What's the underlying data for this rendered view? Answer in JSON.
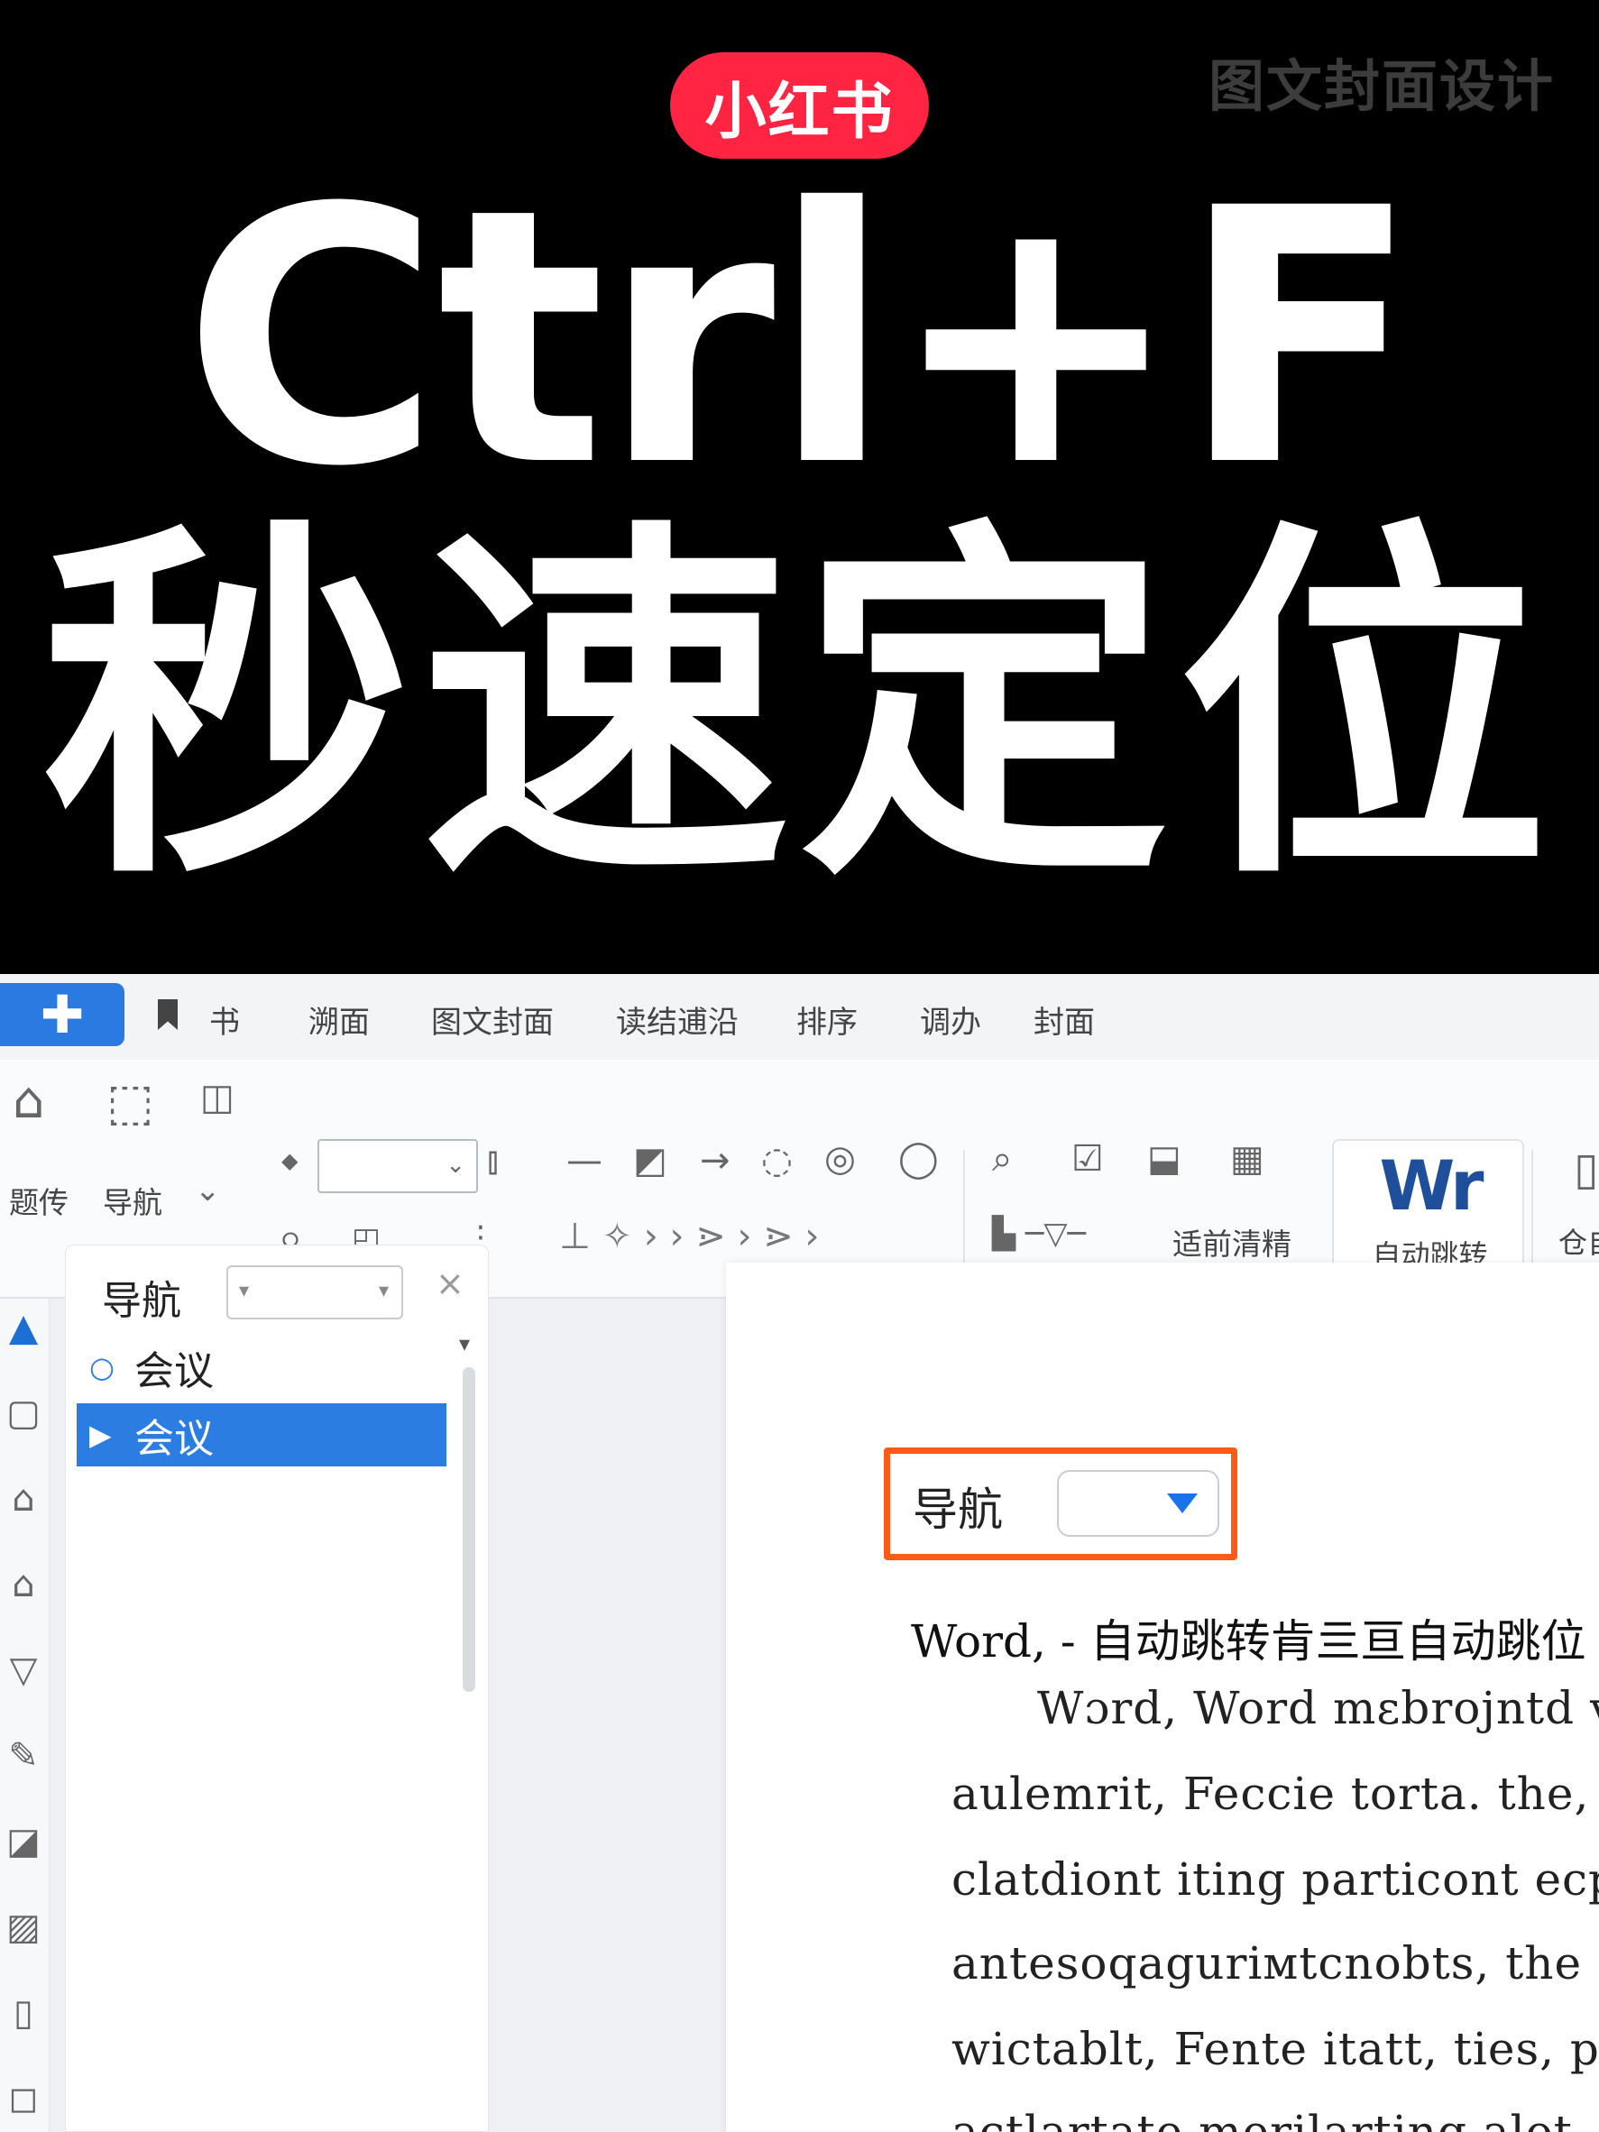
{
  "cover": {
    "badge": "小红书",
    "watermark": "图文封面设计",
    "headline_line1": "Ctrl+F",
    "headline_line2": "秒速定位",
    "colors": {
      "badge_red": "#ff2442",
      "background": "#000000",
      "text": "#ffffff"
    }
  },
  "app": {
    "menu_icon": "plus-icon",
    "tabs": [
      {
        "label": "书",
        "icon": "bookmark-icon"
      },
      {
        "label": "溯面"
      },
      {
        "label": "图文封面"
      },
      {
        "label": "读结逋沿"
      },
      {
        "label": "排序"
      },
      {
        "label": "调办"
      },
      {
        "label": "封面"
      }
    ],
    "ribbon": {
      "labels": {
        "left_tool": "题传",
        "nav": "导航",
        "clear": "适前清精",
        "autojump": "自动跳转",
        "autojump_icon_text": "Wr",
        "cut_off": "仓自"
      }
    },
    "nav_pane": {
      "title": "导航",
      "close": "×",
      "items": [
        {
          "label": "会议",
          "icon": "circle-icon",
          "selected": false
        },
        {
          "label": "会议",
          "icon": "triangle-right-icon",
          "selected": true
        }
      ],
      "accent": "#2b7de1"
    },
    "document": {
      "callout_label": "导航",
      "callout_color": "#ff5a16",
      "heading": "Word, - 自动跳转肯亖亘自动跳位",
      "lines": [
        "Wɔrd, Word mɛbrojntd vie",
        "aulemrit, Feccie torta. the,",
        "clatdiont iting particont ecple",
        "antesoqaguriмtcnobts, the ci",
        "wictablt, Fente itatt, ties, pa",
        "actlartate merilarting alot."
      ]
    }
  }
}
